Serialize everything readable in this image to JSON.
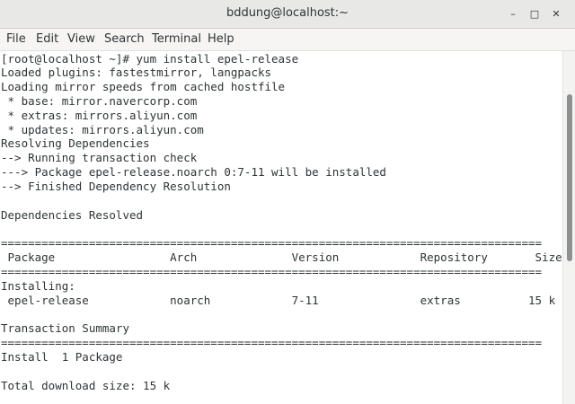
{
  "window": {
    "title": "bddung@localhost:~",
    "minimize": "–",
    "maximize": "□",
    "close": "✕"
  },
  "menu": [
    "File",
    "Edit",
    "View",
    "Search",
    "Terminal",
    "Help"
  ],
  "terminal": {
    "lines": [
      "[root@localhost ~]# yum install epel-release",
      "Loaded plugins: fastestmirror, langpacks",
      "Loading mirror speeds from cached hostfile",
      " * base: mirror.navercorp.com",
      " * extras: mirrors.aliyun.com",
      " * updates: mirrors.aliyun.com",
      "Resolving Dependencies",
      "--> Running transaction check",
      "---> Package epel-release.noarch 0:7-11 will be installed",
      "--> Finished Dependency Resolution",
      "",
      "Dependencies Resolved",
      "",
      "================================================================================",
      " Package                 Arch              Version            Repository       Size",
      "================================================================================",
      "Installing:",
      " epel-release            noarch            7-11               extras          15 k",
      "",
      "Transaction Summary",
      "================================================================================",
      "Install  1 Package",
      "",
      "Total download size: 15 k"
    ]
  }
}
